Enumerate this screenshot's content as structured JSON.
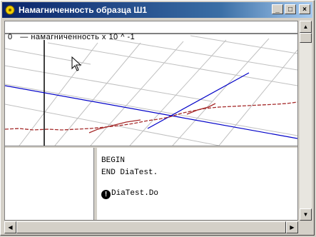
{
  "window": {
    "title": "Намагниченность образца Ш1",
    "buttons": {
      "minimize": "_",
      "maximize": "□",
      "close": "×"
    }
  },
  "plot": {
    "axis_label": "0   — намагниченность x 10 ^ -1",
    "colors": {
      "grid": "#c0c0c0",
      "axis": "#0000c8",
      "curve": "#a52a2a",
      "frame": "#000000"
    }
  },
  "log": {
    "lines": [
      "BEGIN",
      "END DiaTest."
    ],
    "warning_icon": "!",
    "warning_text": "DiaTest.Do"
  }
}
